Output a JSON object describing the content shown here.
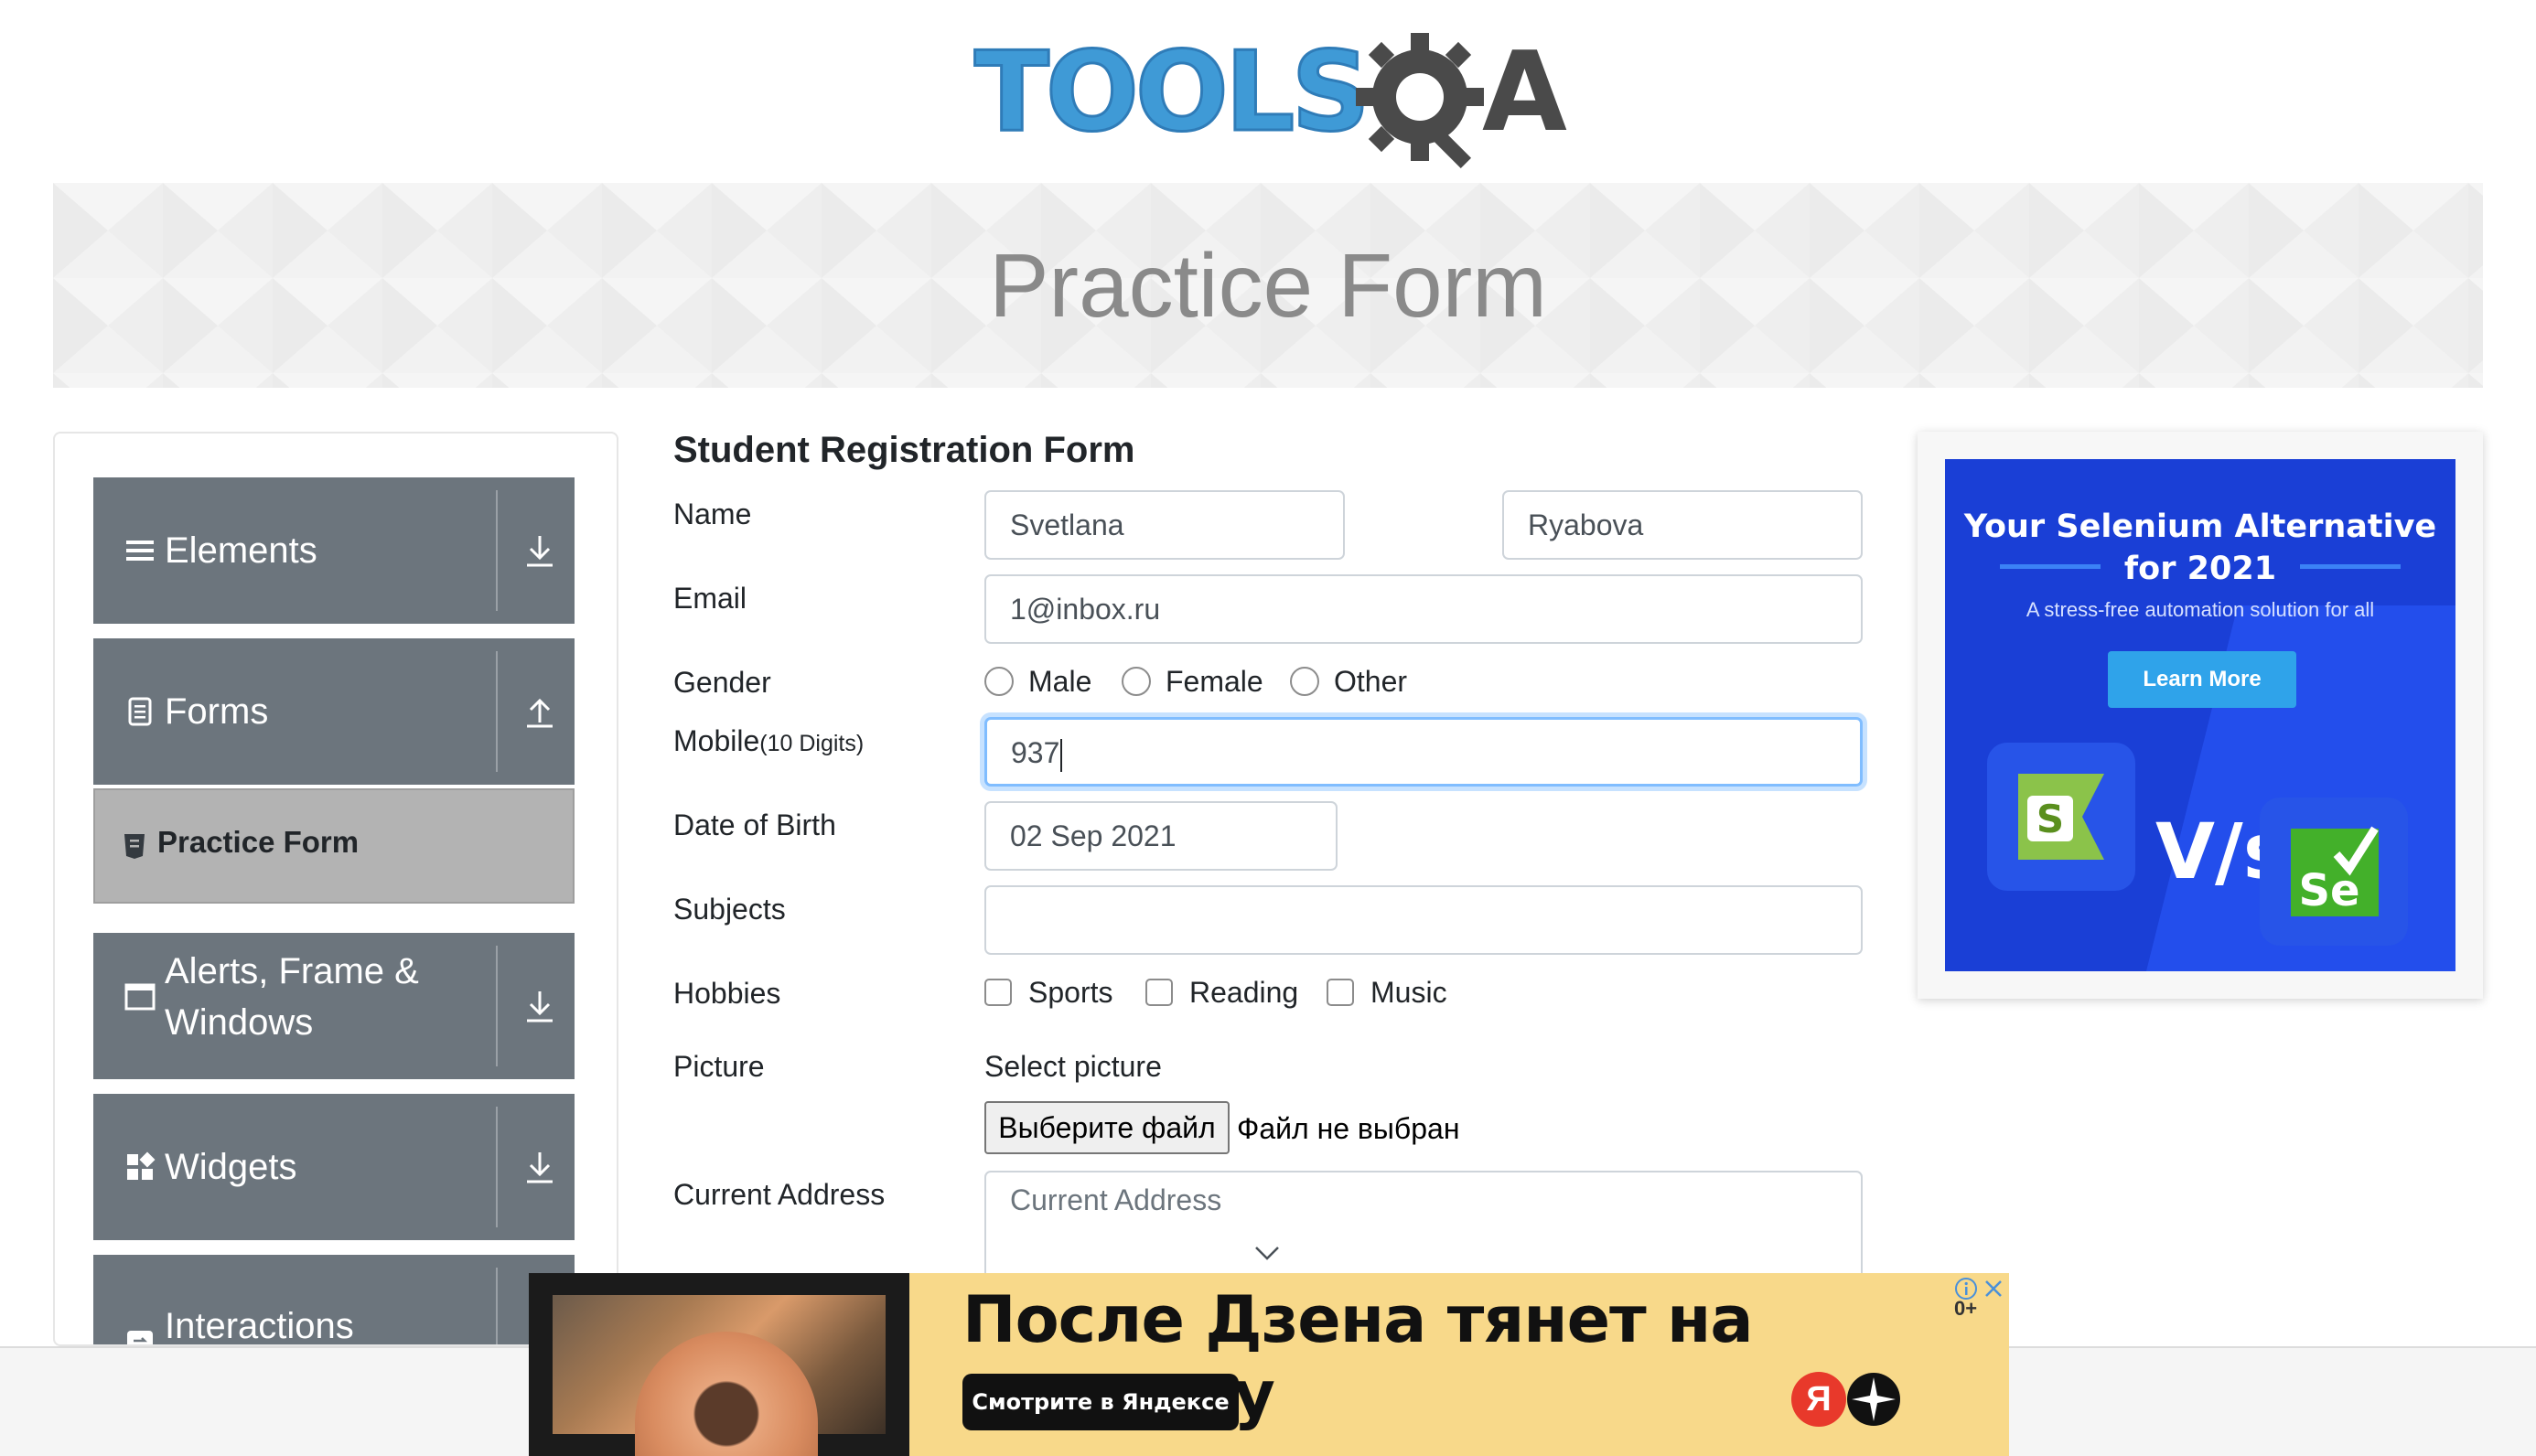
{
  "header": {
    "logo_text": "TOOLSQA"
  },
  "banner": {
    "title": "Practice Form"
  },
  "sidebar": {
    "groups": [
      {
        "label": "Elements",
        "icon": "hamburger-icon",
        "arrow": "download-icon"
      },
      {
        "label": "Forms",
        "icon": "document-icon",
        "arrow": "upload-icon"
      },
      {
        "label": "Alerts, Frame &",
        "label2": "Windows",
        "icon": "window-icon",
        "arrow": "download-icon"
      },
      {
        "label": "Widgets",
        "icon": "widgets-icon",
        "arrow": "download-icon"
      },
      {
        "label": "Interactions",
        "icon": "interactions-icon",
        "arrow": "download-icon"
      }
    ],
    "active_item": {
      "label": "Practice Form",
      "icon": "html-icon"
    }
  },
  "form": {
    "title": "Student Registration Form",
    "labels": {
      "name": "Name",
      "email": "Email",
      "gender": "Gender",
      "mobile": "Mobile",
      "mobile_hint": "(10 Digits)",
      "dob": "Date of Birth",
      "subjects": "Subjects",
      "hobbies": "Hobbies",
      "picture": "Picture",
      "current_address": "Current Address"
    },
    "first_name": "Svetlana",
    "last_name": "Ryabova",
    "email": "1@inbox.ru",
    "gender_options": [
      "Male",
      "Female",
      "Other"
    ],
    "mobile": "937",
    "dob": "02 Sep 2021",
    "subjects": "",
    "hobbies_options": [
      "Sports",
      "Reading",
      "Music"
    ],
    "picture_label": "Select picture",
    "file_button": "Выберите файл",
    "file_status": "Файл не выбран",
    "address_placeholder": "Current Address"
  },
  "right_ad": {
    "title_line1": "Your Selenium Alternative",
    "title_line2": "for 2021",
    "subtitle": "A stress-free automation solution for all",
    "button": "Learn More",
    "logo_left": "S",
    "vs": "V/s",
    "logo_right": "Se",
    "bg_color": "#1a3fd6",
    "button_color": "#2fa3ea"
  },
  "bottom_ad": {
    "headline": "После Дзена тянет на природу",
    "button": "Смотрите в Яндексе",
    "brand_letter": "Я",
    "age_rating": "0+",
    "bg_color": "#f8d98a"
  }
}
